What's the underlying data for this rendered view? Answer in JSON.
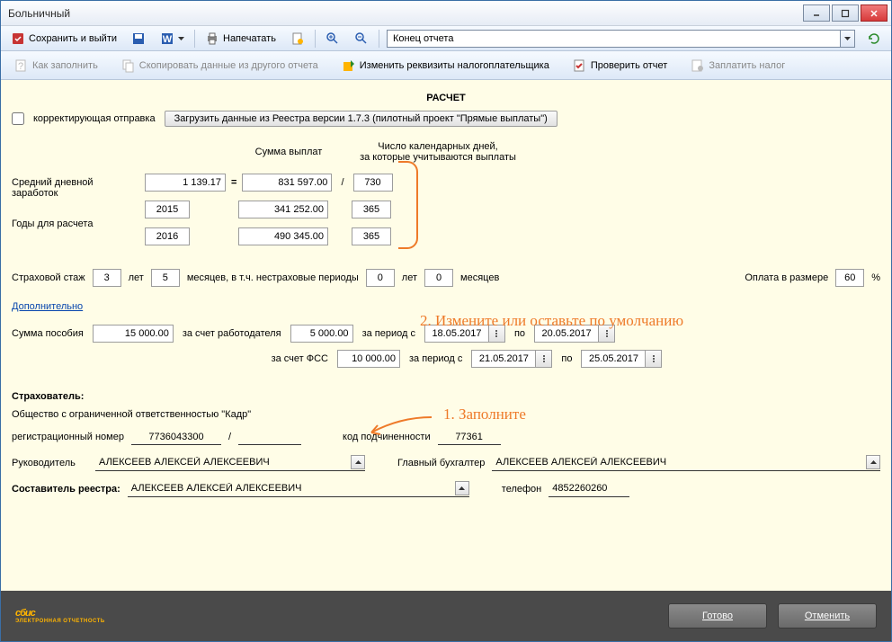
{
  "window": {
    "title": "Больничный"
  },
  "tb1": {
    "save_exit": "Сохранить и выйти",
    "print": "Напечатать",
    "combo_value": "Конец отчета"
  },
  "tb2": {
    "how": "Как заполнить",
    "copy": "Скопировать данные из другого отчета",
    "change_req": "Изменить реквизиты налогоплательщика",
    "check": "Проверить отчет",
    "pay": "Заплатить налог"
  },
  "calc": {
    "header": "РАСЧЕТ",
    "corrective_label": "корректирующая отправка",
    "load_btn": "Загрузить данные из Реестра версии 1.7.3 (пилотный проект \"Прямые выплаты\")",
    "hdr_sum": "Сумма выплат",
    "hdr_days": "Число календарных дней,\nза которые учитываются выплаты",
    "avg_label": "Средний дневной\nзаработок",
    "avg_value": "1 139.17",
    "sum_total": "831 597.00",
    "days_total": "730",
    "years_label": "Годы для расчета",
    "year1": "2015",
    "sum1": "341 252.00",
    "days1": "365",
    "year2": "2016",
    "sum2": "490 345.00",
    "days2": "365"
  },
  "stazh": {
    "label": "Страховой стаж",
    "years": "3",
    "years_u": "лет",
    "months": "5",
    "months_u": "месяцев, в т.ч. нестраховые периоды",
    "ns_years": "0",
    "ns_years_u": "лет",
    "ns_months": "0",
    "ns_months_u": "месяцев",
    "pay_label": "Оплата в размере",
    "pay_pct": "60",
    "pct": "%"
  },
  "dop_link": "Дополнительно",
  "posob": {
    "sum_label": "Сумма пособия",
    "sum": "15 000.00",
    "emp_label": "за счет работодателя",
    "emp_amount": "5 000.00",
    "period_from": "за период с",
    "period_to": "по",
    "emp_from": "18.05.2017",
    "emp_to": "20.05.2017",
    "fss_label": "за счет ФСС",
    "fss_amount": "10 000.00",
    "fss_from": "21.05.2017",
    "fss_to": "25.05.2017"
  },
  "insurer": {
    "label": "Страхователь:",
    "name": "Общество с ограниченной ответственностью \"Кадр\"",
    "reg_label": "регистрационный номер",
    "reg_num": "7736043300",
    "sub_label": "код подчиненности",
    "sub_code": "77361",
    "head_label": "Руководитель",
    "head": "АЛЕКСЕЕВ АЛЕКСЕЙ АЛЕКСЕЕВИЧ",
    "acc_label": "Главный бухгалтер",
    "acc": "АЛЕКСЕЕВ АЛЕКСЕЙ АЛЕКСЕЕВИЧ",
    "reg_maker_label": "Составитель реестра:",
    "reg_maker": "АЛЕКСЕЕВ АЛЕКСЕЙ АЛЕКСЕЕВИЧ",
    "phone_label": "телефон",
    "phone": "4852260260"
  },
  "anno": {
    "a1": "1. Заполните",
    "a2": "2. Измените или оставьте по умолчанию"
  },
  "footer": {
    "ready": "Готово",
    "cancel": "Отменить",
    "logo": "сбис",
    "logo_sub": "ЭЛЕКТРОННАЯ ОТЧЕТНОСТЬ"
  }
}
